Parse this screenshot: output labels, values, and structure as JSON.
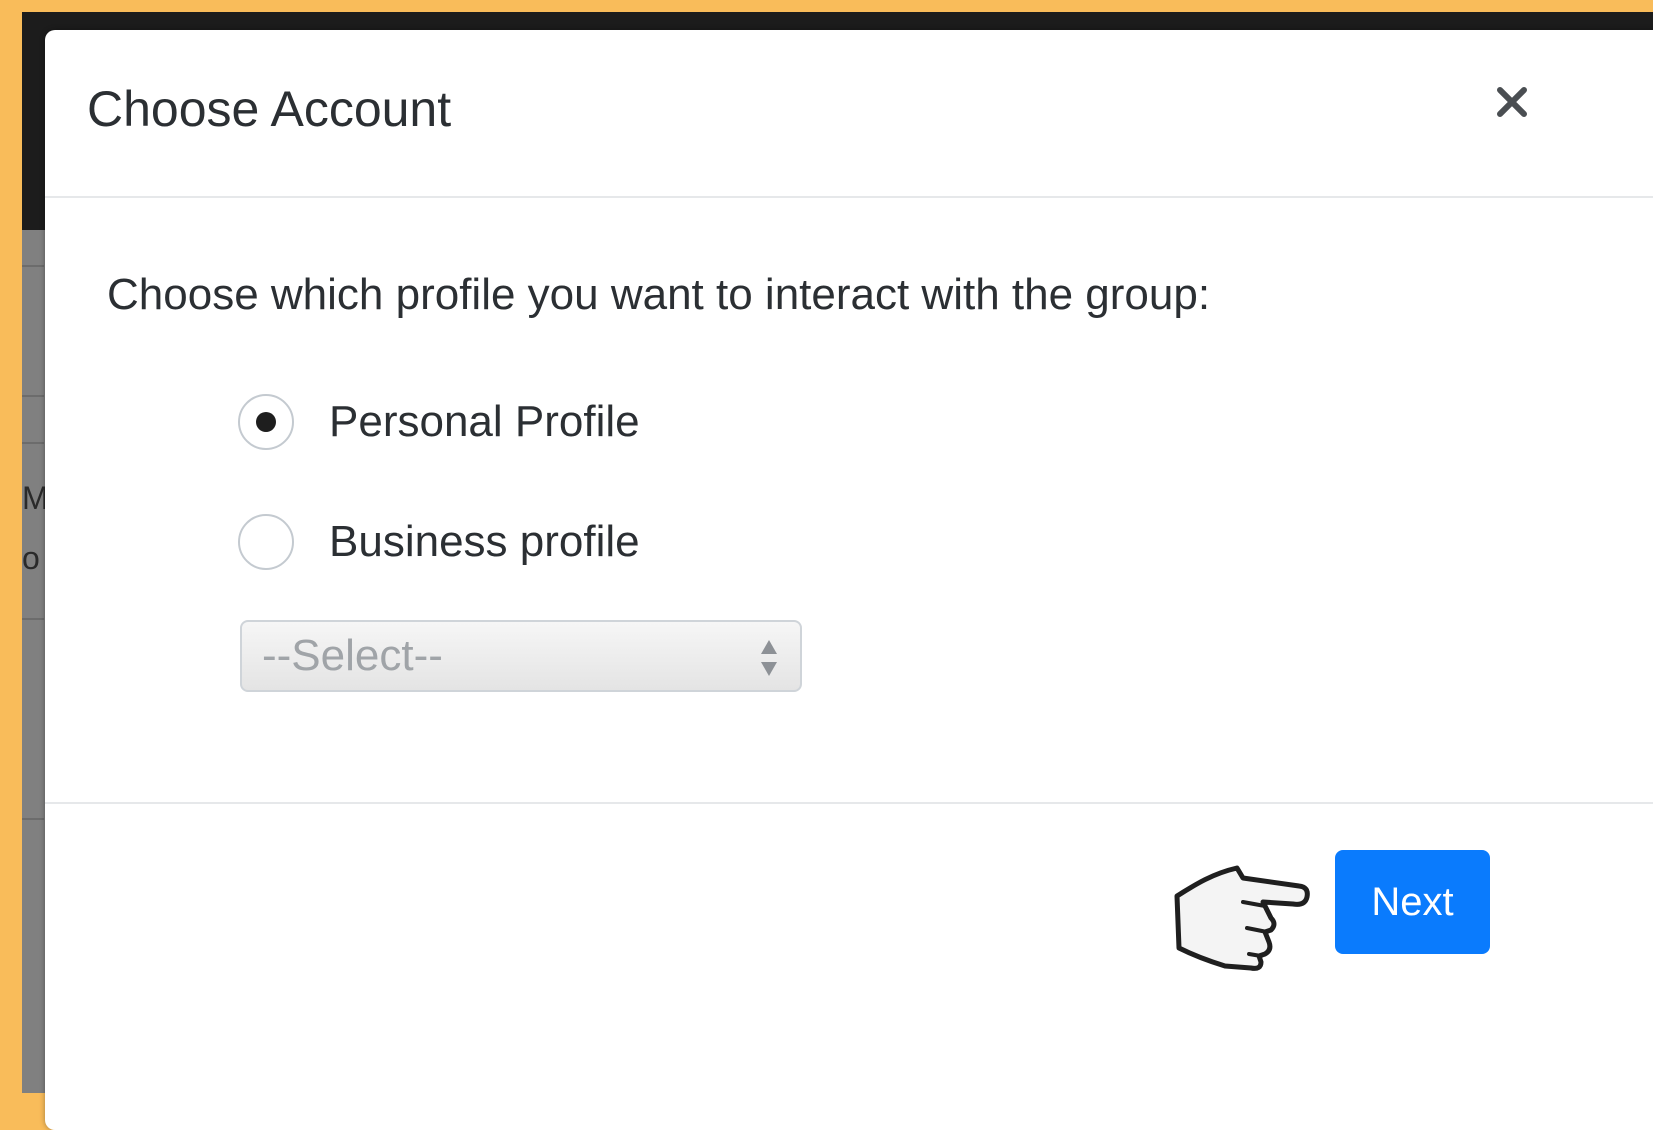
{
  "modal": {
    "title": "Choose Account",
    "close_label": "×",
    "prompt": "Choose which profile you want to interact with the group:",
    "options": [
      {
        "label": "Personal Profile",
        "checked": true
      },
      {
        "label": "Business profile",
        "checked": false
      }
    ],
    "select": {
      "selected": "--Select--",
      "disabled": true
    },
    "next_label": "Next"
  },
  "background": {
    "peek_text_lines": [
      "M",
      "o"
    ]
  },
  "colors": {
    "frame": "#f9bc5a",
    "overlay": "#808080",
    "dark_header": "#1c1c1c",
    "primary": "#0a7bfd",
    "text": "#2b2f33",
    "muted": "#a0a4a8"
  },
  "icons": {
    "close": "close-icon",
    "select_arrows": "updown-arrows-icon",
    "pointer": "pointing-hand-icon"
  }
}
